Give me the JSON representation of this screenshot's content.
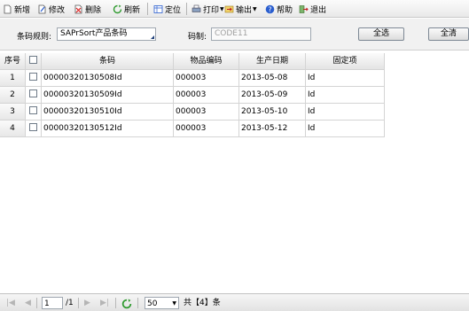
{
  "toolbar": {
    "new_label": "新增",
    "edit_label": "修改",
    "delete_label": "删除",
    "refresh_label": "刷新",
    "locate_label": "定位",
    "print_label": "打印",
    "export_label": "输出",
    "help_label": "帮助",
    "exit_label": "退出"
  },
  "filter": {
    "barcode_rule_label": "条码规则:",
    "barcode_rule_value": "SAPrSort产品条码",
    "code_label": "码制:",
    "code_value": "CODE11",
    "select_all_label": "全选",
    "clear_label": "全清"
  },
  "table": {
    "headers": [
      "序号",
      "",
      "条码",
      "物品编码",
      "生产日期",
      "固定项"
    ],
    "rows": [
      {
        "num": "1",
        "barcode": "00000320130508Id",
        "item_code": "000003",
        "date": "2013-05-08",
        "fixed": "Id"
      },
      {
        "num": "2",
        "barcode": "00000320130509Id",
        "item_code": "000003",
        "date": "2013-05-09",
        "fixed": "Id"
      },
      {
        "num": "3",
        "barcode": "00000320130510Id",
        "item_code": "000003",
        "date": "2013-05-10",
        "fixed": "Id"
      },
      {
        "num": "4",
        "barcode": "00000320130512Id",
        "item_code": "000003",
        "date": "2013-05-12",
        "fixed": "Id"
      }
    ]
  },
  "pager": {
    "page": "1",
    "total_pages": "/1",
    "page_size": "50",
    "total_text": "共【4】条"
  },
  "colors": {
    "toolbar_bg": "#efefef",
    "grid_line": "#d4d4d4",
    "refresh_icon": "#2e9a2e",
    "help_icon": "#2a5ecf"
  }
}
